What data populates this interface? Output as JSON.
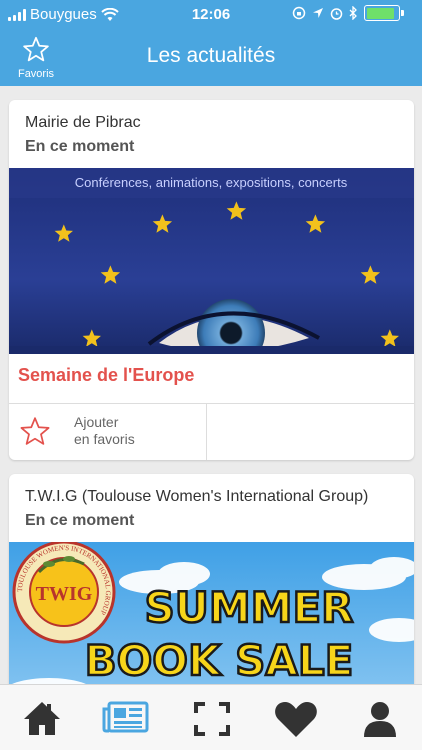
{
  "status_bar": {
    "carrier": "Bouygues",
    "time": "12:06",
    "battery_level": 0.9
  },
  "header": {
    "title": "Les actualités",
    "favorites_label": "Favoris"
  },
  "cards": [
    {
      "organization": "Mairie de Pibrac",
      "status": "En ce moment",
      "image_caption": "Conférences, animations, expositions, concerts",
      "title": "Semaine de l'Europe",
      "fav_line1": "Ajouter",
      "fav_line2": "en favoris"
    },
    {
      "organization": "T.W.I.G (Toulouse Women's International Group)",
      "status": "En ce moment",
      "badge_text": "TWIG",
      "badge_ring_text": "TOULOUSE WOMEN'S INTERNATIONAL GROUP",
      "poster_line1": "SUMMER",
      "poster_line2": "BOOK  SALE"
    }
  ],
  "tabbar": {
    "items": [
      {
        "name": "home",
        "icon": "home-icon"
      },
      {
        "name": "news",
        "icon": "newspaper-icon",
        "active": true
      },
      {
        "name": "scan",
        "icon": "scan-icon"
      },
      {
        "name": "favorites",
        "icon": "heart-icon"
      },
      {
        "name": "profile",
        "icon": "user-icon"
      }
    ]
  },
  "colors": {
    "header": "#4aa6e0",
    "accent": "#e3524d",
    "active_tab": "#4aa6e0",
    "tab_icon": "#333333"
  }
}
